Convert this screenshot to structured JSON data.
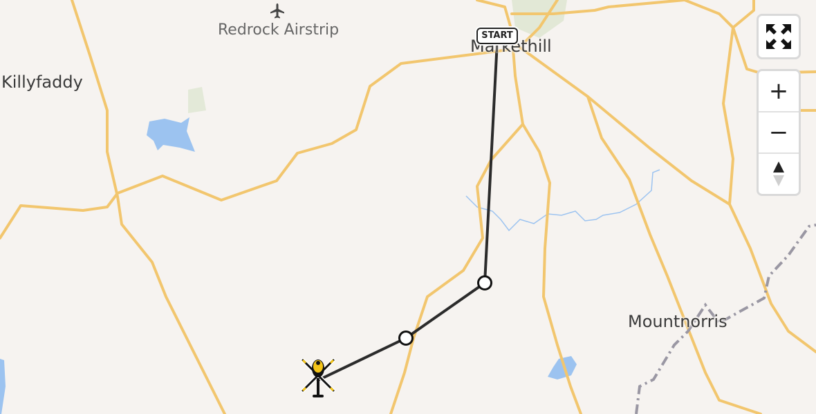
{
  "map": {
    "places": {
      "markethill": "Markethill",
      "killyfaddy": "Killyfaddy",
      "mountnorris": "Mountnorris"
    },
    "airstrip": {
      "label": "Redrock Airstrip",
      "icon": "airplane-icon"
    },
    "route": {
      "start_label": "START",
      "waypoints": 2,
      "end_marker": "helicopter-icon"
    },
    "colors": {
      "background": "#f6f3f0",
      "road": "#f2c66e",
      "water": "#9cc3f0",
      "route": "#2b2b2b",
      "border": "#9a97a3"
    }
  },
  "controls": {
    "fullscreen_icon": "fullscreen-icon",
    "zoom_in": "+",
    "zoom_out": "−",
    "compass_icon": "compass-icon"
  }
}
